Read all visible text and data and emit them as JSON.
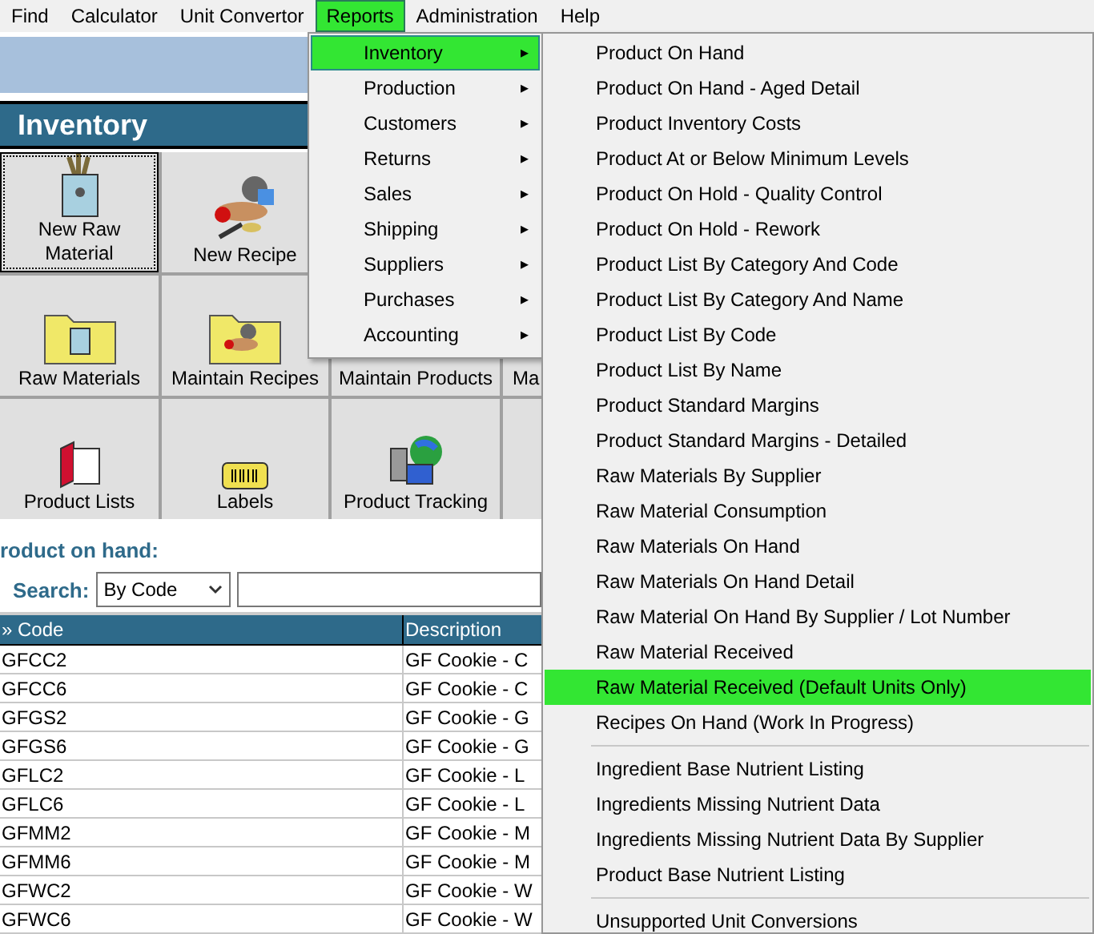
{
  "menubar": [
    {
      "label": "Find",
      "selected": false
    },
    {
      "label": "Calculator",
      "selected": false
    },
    {
      "label": "Unit Convertor",
      "selected": false
    },
    {
      "label": "Reports",
      "selected": true
    },
    {
      "label": "Administration",
      "selected": false
    },
    {
      "label": "Help",
      "selected": false
    }
  ],
  "panel_title": "Inventory",
  "tiles": [
    [
      {
        "label": "New Raw Material",
        "kind": "bag",
        "selected": true
      },
      {
        "label": "New Recipe",
        "kind": "food",
        "selected": false
      }
    ],
    [
      {
        "label": "Raw Materials",
        "kind": "folder-bag",
        "selected": false
      },
      {
        "label": "Maintain Recipes",
        "kind": "folder-food",
        "selected": false
      },
      {
        "label": "Maintain Products",
        "kind": "plain",
        "selected": false
      },
      {
        "label": "Ma",
        "kind": "plain",
        "selected": false
      }
    ],
    [
      {
        "label": "Product Lists",
        "kind": "book",
        "selected": false
      },
      {
        "label": "Labels",
        "kind": "barcode",
        "selected": false
      },
      {
        "label": "Product Tracking",
        "kind": "computer",
        "selected": false
      },
      {
        "kind": "plain",
        "selected": false
      }
    ]
  ],
  "section_title": "roduct on hand:",
  "search": {
    "label": "Search:",
    "mode": "By Code"
  },
  "table": {
    "columns": [
      "» Code",
      "Description"
    ],
    "rows": [
      [
        "GFCC2",
        "GF Cookie - C"
      ],
      [
        "GFCC6",
        "GF Cookie - C"
      ],
      [
        "GFGS2",
        "GF Cookie - G"
      ],
      [
        "GFGS6",
        "GF Cookie - G"
      ],
      [
        "GFLC2",
        "GF Cookie - L"
      ],
      [
        "GFLC6",
        "GF Cookie - L"
      ],
      [
        "GFMM2",
        "GF Cookie - M"
      ],
      [
        "GFMM6",
        "GF Cookie - M"
      ],
      [
        "GFWC2",
        "GF Cookie - W"
      ],
      [
        "GFWC6",
        "GF Cookie - W"
      ]
    ]
  },
  "reports_menu": [
    {
      "label": "Inventory",
      "selected": true,
      "arrow": "▸"
    },
    {
      "label": "Production",
      "selected": false,
      "arrow": "▸"
    },
    {
      "label": "Customers",
      "selected": false,
      "arrow": "▸"
    },
    {
      "label": "Returns",
      "selected": false,
      "arrow": "▸"
    },
    {
      "label": "Sales",
      "selected": false,
      "arrow": "▸"
    },
    {
      "label": "Shipping",
      "selected": false,
      "arrow": "▸"
    },
    {
      "label": "Suppliers",
      "selected": false,
      "arrow": "▸"
    },
    {
      "label": "Purchases",
      "selected": false,
      "arrow": "▸"
    },
    {
      "label": "Accounting",
      "selected": false,
      "arrow": "▸"
    }
  ],
  "inventory_menu": [
    [
      {
        "label": "Product On Hand",
        "selected": false
      },
      {
        "label": "Product On Hand - Aged Detail",
        "selected": false
      },
      {
        "label": "Product Inventory Costs",
        "selected": false
      },
      {
        "label": "Product At or Below Minimum Levels",
        "selected": false
      },
      {
        "label": "Product On Hold - Quality Control",
        "selected": false
      },
      {
        "label": "Product On Hold - Rework",
        "selected": false
      },
      {
        "label": "Product List By Category And Code",
        "selected": false
      },
      {
        "label": "Product List By Category And Name",
        "selected": false
      },
      {
        "label": "Product List By Code",
        "selected": false
      },
      {
        "label": "Product List By Name",
        "selected": false
      },
      {
        "label": "Product Standard Margins",
        "selected": false
      },
      {
        "label": "Product Standard Margins - Detailed",
        "selected": false
      },
      {
        "label": "Raw Materials By Supplier",
        "selected": false
      },
      {
        "label": "Raw Material Consumption",
        "selected": false
      },
      {
        "label": "Raw Materials On Hand",
        "selected": false
      },
      {
        "label": "Raw Materials On Hand Detail",
        "selected": false
      },
      {
        "label": "Raw Material On Hand By Supplier / Lot Number",
        "selected": false
      },
      {
        "label": "Raw Material Received",
        "selected": false
      },
      {
        "label": "Raw Material Received (Default Units Only)",
        "selected": true
      },
      {
        "label": "Recipes On Hand (Work In Progress)",
        "selected": false
      }
    ],
    [
      {
        "label": "Ingredient Base Nutrient Listing",
        "selected": false
      },
      {
        "label": "Ingredients Missing Nutrient Data",
        "selected": false
      },
      {
        "label": "Ingredients Missing Nutrient Data By Supplier",
        "selected": false
      },
      {
        "label": "Product Base Nutrient Listing",
        "selected": false
      }
    ],
    [
      {
        "label": "Unsupported Unit Conversions",
        "selected": false
      }
    ]
  ]
}
